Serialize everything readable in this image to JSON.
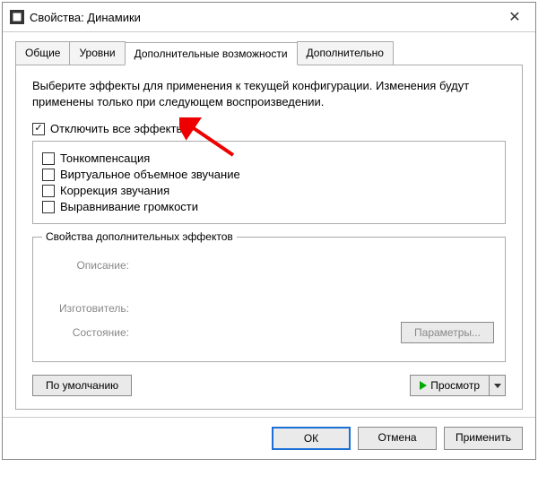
{
  "titlebar": {
    "title": "Свойства: Динамики"
  },
  "tabs": {
    "general": "Общие",
    "levels": "Уровни",
    "enhancements": "Дополнительные возможности",
    "advanced": "Дополнительно"
  },
  "instruction": "Выберите эффекты для применения к текущей конфигурации. Изменения будут применены только при следующем воспроизведении.",
  "disable_all": "Отключить все эффекты",
  "effects": [
    "Тонкомпенсация",
    "Виртуальное объемное звучание",
    "Коррекция звучания",
    "Выравнивание громкости"
  ],
  "props": {
    "legend": "Свойства дополнительных эффектов",
    "desc_label": "Описание:",
    "desc_value": "",
    "vendor_label": "Изготовитель:",
    "vendor_value": "",
    "status_label": "Состояние:",
    "status_value": "",
    "params_button": "Параметры..."
  },
  "bottom": {
    "defaults": "По умолчанию",
    "preview": "Просмотр"
  },
  "dialog": {
    "ok": "ОК",
    "cancel": "Отмена",
    "apply": "Применить"
  }
}
